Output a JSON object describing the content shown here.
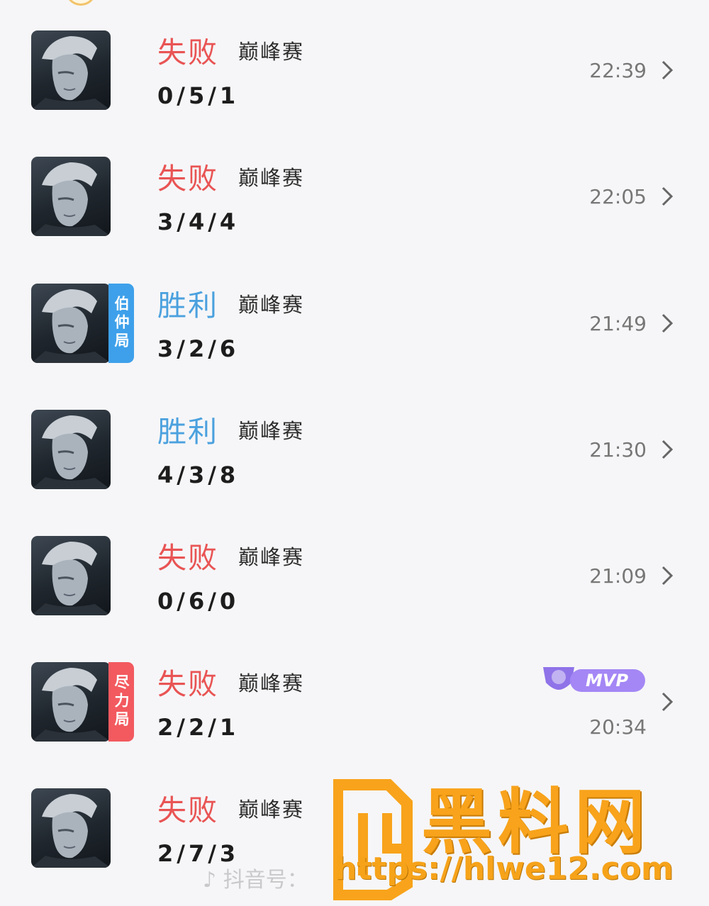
{
  "matches": [
    {
      "result": "失败",
      "result_type": "lose",
      "mode": "巅峰赛",
      "kda": "0/5/1",
      "time": "22:39",
      "tag": null
    },
    {
      "result": "失败",
      "result_type": "lose",
      "mode": "巅峰赛",
      "kda": "3/4/4",
      "time": "22:05",
      "tag": null
    },
    {
      "result": "胜利",
      "result_type": "win",
      "mode": "巅峰赛",
      "kda": "3/2/6",
      "time": "21:49",
      "tag": "伯仲局",
      "tag_color": "#3ea0ea"
    },
    {
      "result": "胜利",
      "result_type": "win",
      "mode": "巅峰赛",
      "kda": "4/3/8",
      "time": "21:30",
      "tag": null
    },
    {
      "result": "失败",
      "result_type": "lose",
      "mode": "巅峰赛",
      "kda": "0/6/0",
      "time": "21:09",
      "tag": null
    },
    {
      "result": "失败",
      "result_type": "lose",
      "mode": "巅峰赛",
      "kda": "2/2/1",
      "time": "20:34",
      "tag": "尽力局",
      "tag_color": "#f25a5f",
      "badge": "MVP"
    },
    {
      "result": "失败",
      "result_type": "lose",
      "mode": "巅峰赛",
      "kda": "2/7/3",
      "time": "",
      "tag": null
    }
  ],
  "icons": {
    "avatar": "hero-portrait-icon",
    "chevron": "chevron-right-icon",
    "mvp": "mvp-trophy-icon",
    "douyin": "douyin-logo-icon"
  },
  "watermark": {
    "title": "黑料网",
    "url": "https://hlwe12.com"
  },
  "douyin_label": "抖音号：",
  "colors": {
    "lose": "#e95454",
    "win": "#4ba1de",
    "watermark": "#f8a31b"
  }
}
